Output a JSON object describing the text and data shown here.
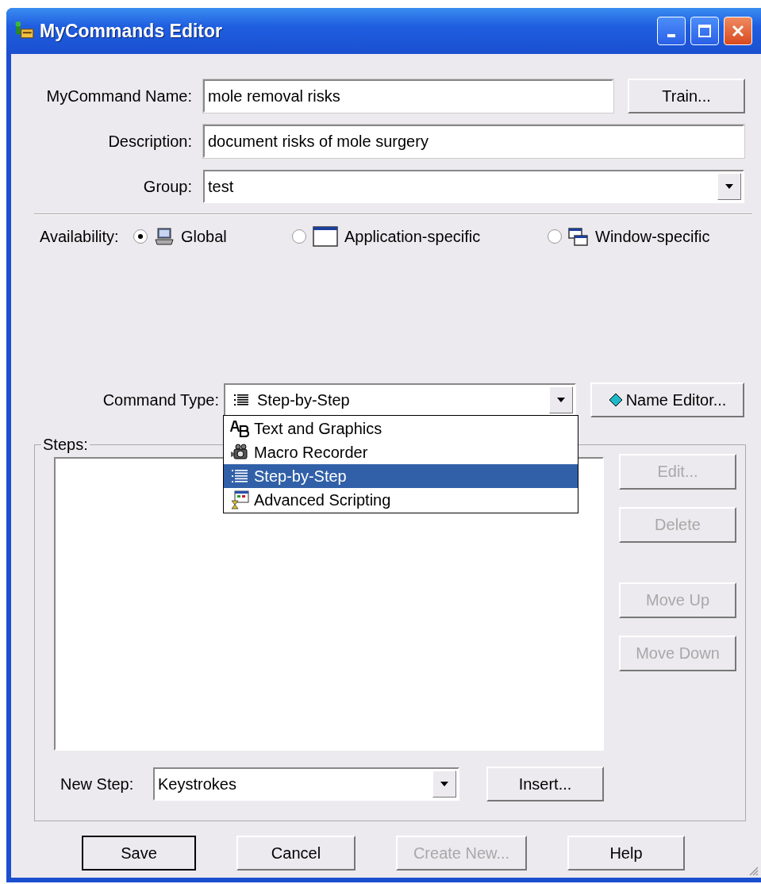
{
  "window": {
    "title": "MyCommands Editor"
  },
  "name_field": {
    "label": "MyCommand Name:",
    "value": "mole removal risks"
  },
  "train_button": {
    "label": "Train..."
  },
  "description_field": {
    "label": "Description:",
    "value": "document risks of mole surgery"
  },
  "group_field": {
    "label": "Group:",
    "value": "test"
  },
  "availability": {
    "label": "Availability:",
    "options": [
      {
        "label": "Global",
        "kind": "computer",
        "selected": true
      },
      {
        "label": "Application-specific",
        "kind": "application",
        "selected": false
      },
      {
        "label": "Window-specific",
        "kind": "windows",
        "selected": false
      }
    ]
  },
  "command_type": {
    "label": "Command Type:",
    "value": "Step-by-Step",
    "kind": "steps",
    "expanded": true,
    "options": [
      {
        "label": "Text and Graphics",
        "kind": "text",
        "selected": false
      },
      {
        "label": "Macro Recorder",
        "kind": "camera",
        "selected": false
      },
      {
        "label": "Step-by-Step",
        "kind": "steps",
        "selected": true
      },
      {
        "label": "Advanced Scripting",
        "kind": "script",
        "selected": false
      }
    ]
  },
  "name_editor_button": {
    "label": "Name Editor..."
  },
  "steps": {
    "label": "Steps:",
    "buttons": [
      {
        "label": "Edit...",
        "disabled": true
      },
      {
        "label": "Delete",
        "disabled": true
      },
      {
        "label": "Move Up",
        "disabled": true
      },
      {
        "label": "Move Down",
        "disabled": true
      }
    ],
    "new_step": {
      "label": "New Step:",
      "value": "Keystrokes"
    },
    "insert_button": {
      "label": "Insert..."
    }
  },
  "buttons": [
    {
      "label": "Save",
      "default": true,
      "disabled": false
    },
    {
      "label": "Cancel",
      "default": false,
      "disabled": false
    },
    {
      "label": "Create New...",
      "default": false,
      "disabled": true
    },
    {
      "label": "Help",
      "default": false,
      "disabled": false
    }
  ]
}
